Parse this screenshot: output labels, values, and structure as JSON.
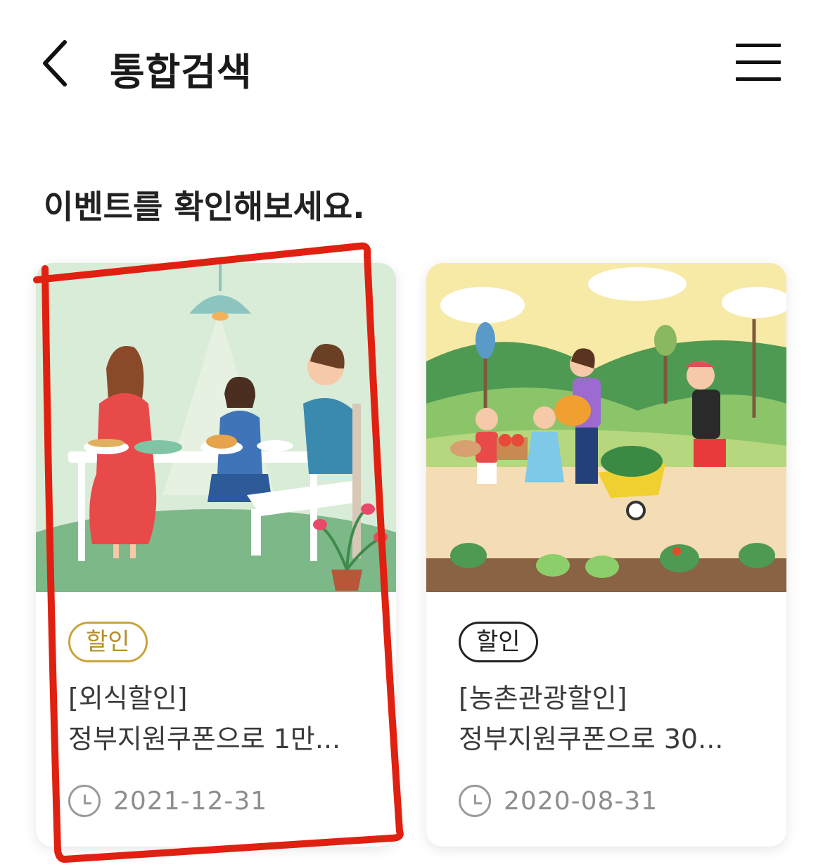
{
  "header": {
    "title": "통합검색",
    "back_icon": "chevron-left-icon",
    "menu_icon": "hamburger-menu-icon"
  },
  "section": {
    "title": "이벤트를 확인해보세요."
  },
  "events": [
    {
      "tag": "할인",
      "tag_color": "#c9a43a",
      "title_line1": "[외식할인]",
      "title_line2": "정부지원쿠폰으로 1만...",
      "date": "2021-12-31",
      "image_desc": "family-dining-illustration"
    },
    {
      "tag": "할인",
      "tag_color": "#222222",
      "title_line1": "[농촌관광할인]",
      "title_line2": "정부지원쿠폰으로 30...",
      "date": "2020-08-31",
      "image_desc": "farm-harvest-illustration"
    }
  ],
  "colors": {
    "annotation": "#e02010"
  }
}
